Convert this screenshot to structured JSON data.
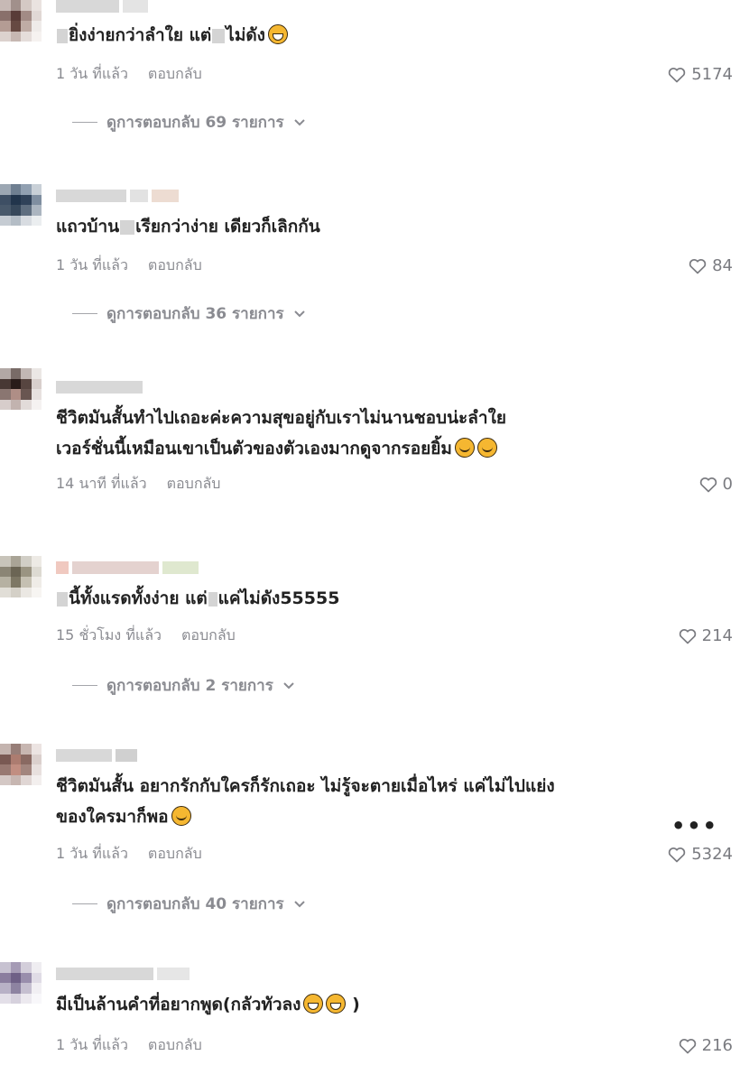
{
  "comments": [
    {
      "text_before": "ยิ่งง่ายกว่าลำใย แต่",
      "text_after": "ไม่ดัง",
      "emojis": [
        "grin"
      ],
      "time": "1 วัน ที่แล้ว",
      "reply_label": "ตอบกลับ",
      "likes": "5174",
      "view_replies": "ดูการตอบกลับ 69 รายการ"
    },
    {
      "text_before": "แถวบ้าน",
      "text_after": "เรียกว่าง่าย เดียวก็เลิกกัน",
      "emojis": [],
      "time": "1 วัน ที่แล้ว",
      "reply_label": "ตอบกลับ",
      "likes": "84",
      "view_replies": "ดูการตอบกลับ 36 รายการ"
    },
    {
      "text_line1": "ชีวิตมันสั้นทำไปเถอะค่ะความสุขอยู่กับเราไม่นานชอบน่ะลำใย",
      "text_line2": "เวอร์ชั่นนี้เหมือนเขาเป็นตัวของตัวเองมากดูจากรอยยิ้ม",
      "emojis": [
        "smile",
        "smile"
      ],
      "time": "14 นาที ที่แล้ว",
      "reply_label": "ตอบกลับ",
      "likes": "0"
    },
    {
      "text_before": "นี้ทั้งแรดทั้งง่าย แต่",
      "text_after": "แค่ไม่ดัง55555",
      "emojis": [],
      "time": "15 ชั่วโมง ที่แล้ว",
      "reply_label": "ตอบกลับ",
      "likes": "214",
      "view_replies": "ดูการตอบกลับ 2 รายการ"
    },
    {
      "text_line1": "ชีวิตมันสั้น อยากรักกับใครก็รักเถอะ ไม่รู้จะตายเมื่อไหร่ แค่ไม่ไปแย่ง",
      "text_line2": "ของใครมาก็พอ",
      "emojis": [
        "smile"
      ],
      "time": "1 วัน ที่แล้ว",
      "reply_label": "ตอบกลับ",
      "likes": "5324",
      "more": "•••",
      "view_replies": "ดูการตอบกลับ 40 รายการ"
    },
    {
      "text_before": "มีเป็นล้านคำที่อยากพูด(กลัวทัวลง",
      "text_after": ")",
      "emojis": [
        "grin",
        "grin"
      ],
      "time": "1 วัน ที่แล้ว",
      "reply_label": "ตอบกลับ",
      "likes": "216"
    }
  ],
  "colors": {
    "text": "#222222",
    "meta": "#8a8b91",
    "background": "#ffffff"
  },
  "icons": [
    "heart-outline-icon",
    "chevron-down-icon",
    "more-dots-icon",
    "avatar-pixelated"
  ]
}
